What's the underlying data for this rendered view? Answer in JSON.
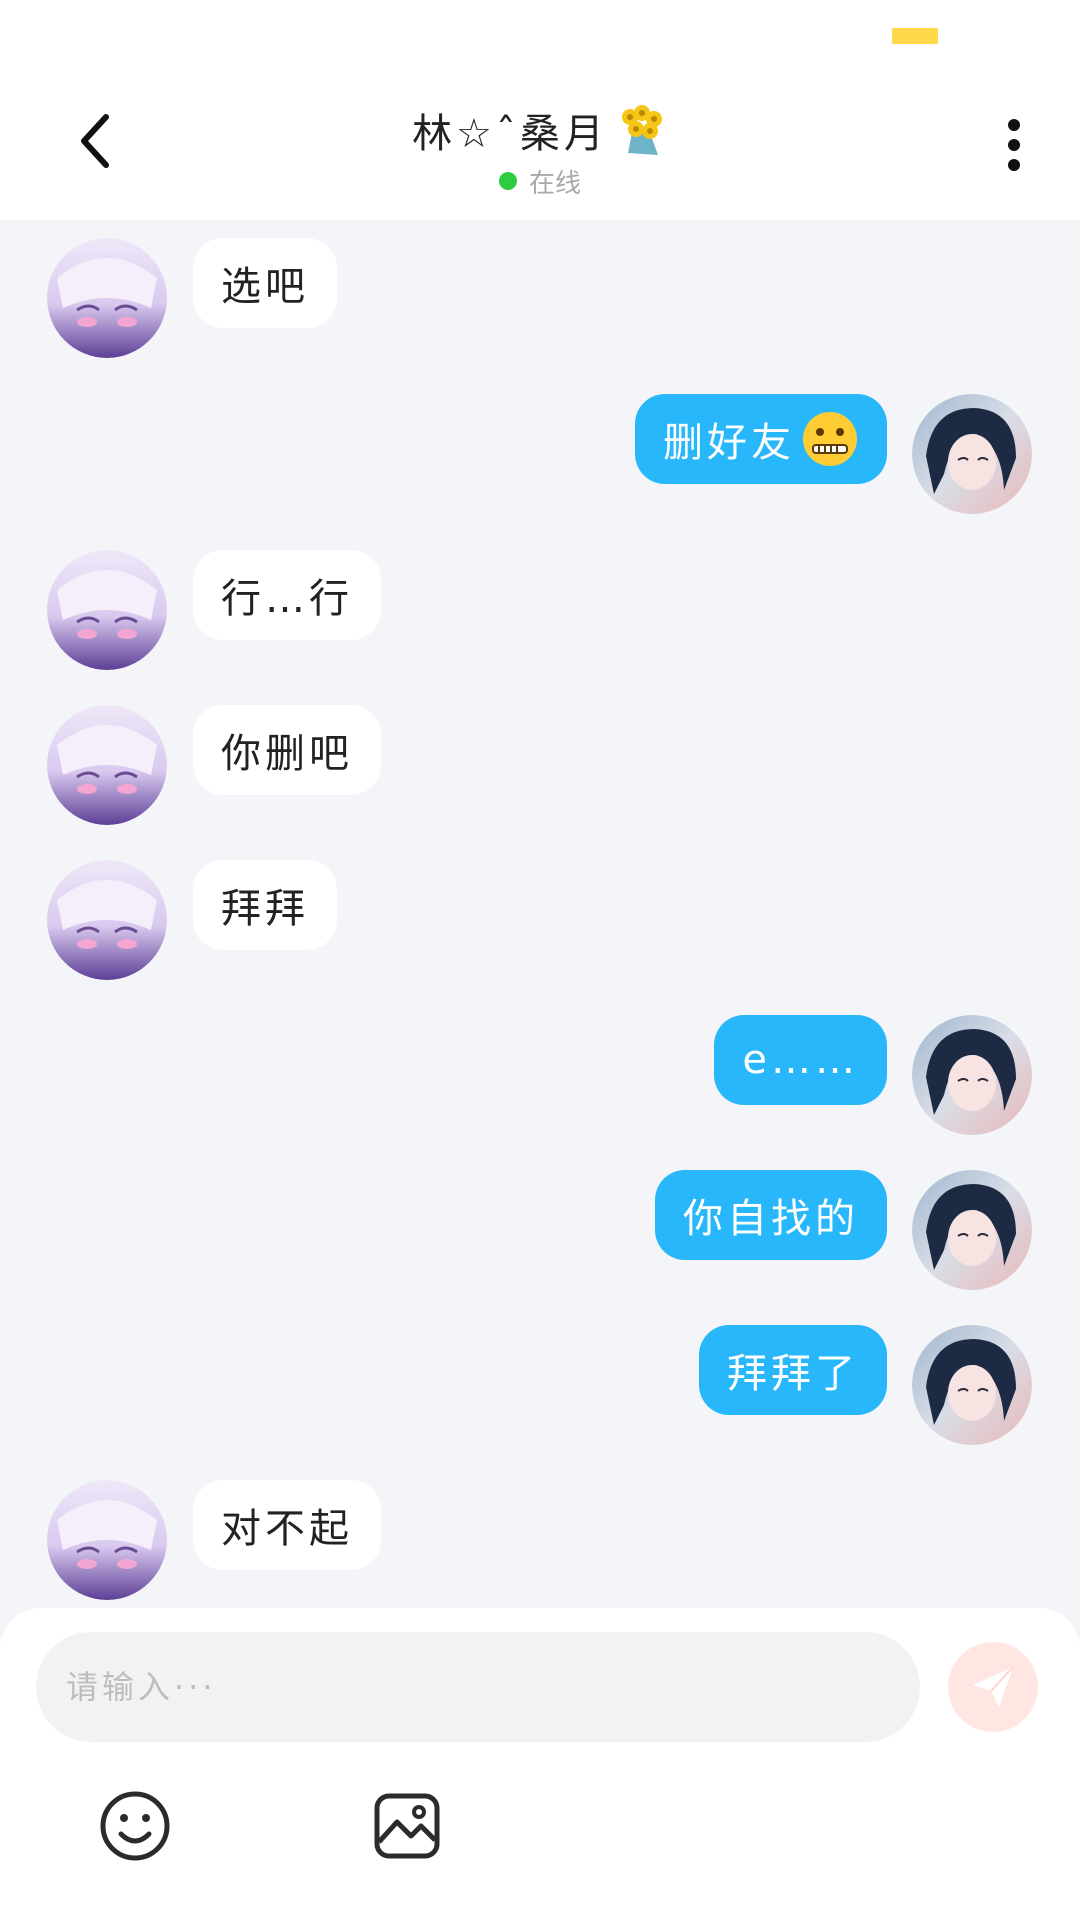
{
  "header": {
    "title": "林☆ˆ桑月",
    "status": "在线"
  },
  "messages": [
    {
      "side": "in",
      "text": "选吧"
    },
    {
      "side": "out",
      "text": "删好友"
    },
    {
      "side": "in",
      "text": "行…行"
    },
    {
      "side": "in",
      "text": "你删吧"
    },
    {
      "side": "in",
      "text": "拜拜"
    },
    {
      "side": "out",
      "text": "e……"
    },
    {
      "side": "out",
      "text": "你自找的"
    },
    {
      "side": "out",
      "text": "拜拜了"
    },
    {
      "side": "in",
      "text": "对不起"
    }
  ],
  "input": {
    "placeholder": "请输入···"
  },
  "colors": {
    "outgoing_bubble": "#27b7fa",
    "incoming_bubble": "#ffffff",
    "online": "#2ecc40",
    "send_button": "#ffe6e2"
  },
  "icons": {
    "back": "back-arrow-icon",
    "more": "more-vertical-icon",
    "emoji": "smiley-icon",
    "image": "image-icon",
    "send": "paper-plane-icon",
    "title_decoration": "flower-bouquet-icon",
    "zipper_emoji": "zipper-mouth-emoji"
  }
}
